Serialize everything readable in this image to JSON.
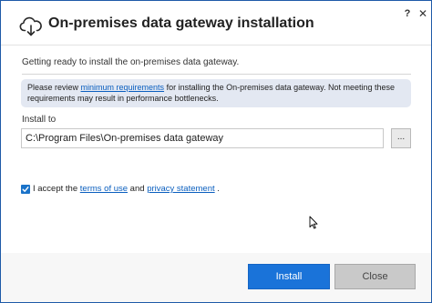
{
  "window": {
    "title": "On-premises data gateway installation",
    "help_label": "?",
    "close_label": "✕"
  },
  "status": {
    "text": "Getting ready to install the on-premises data gateway."
  },
  "info": {
    "prefix": "Please review ",
    "link": "minimum requirements",
    "suffix": " for installing the On-premises data gateway. Not meeting these requirements may result in performance bottlenecks."
  },
  "install": {
    "label": "Install to",
    "path_value": "C:\\Program Files\\On-premises data gateway",
    "browse_label": "..."
  },
  "accept": {
    "checked": true,
    "prefix": "I accept the ",
    "terms_link": "terms of use",
    "middle": " and ",
    "privacy_link": "privacy statement",
    "suffix": " ."
  },
  "footer": {
    "install_label": "Install",
    "close_label": "Close"
  },
  "colors": {
    "accent": "#1a73d9",
    "link": "#0b5fbf",
    "info_bg": "#e3e8f2"
  },
  "icons": {
    "app": "cloud-download-icon",
    "checkbox": "checkmark-icon",
    "cursor": "mouse-pointer-icon"
  }
}
